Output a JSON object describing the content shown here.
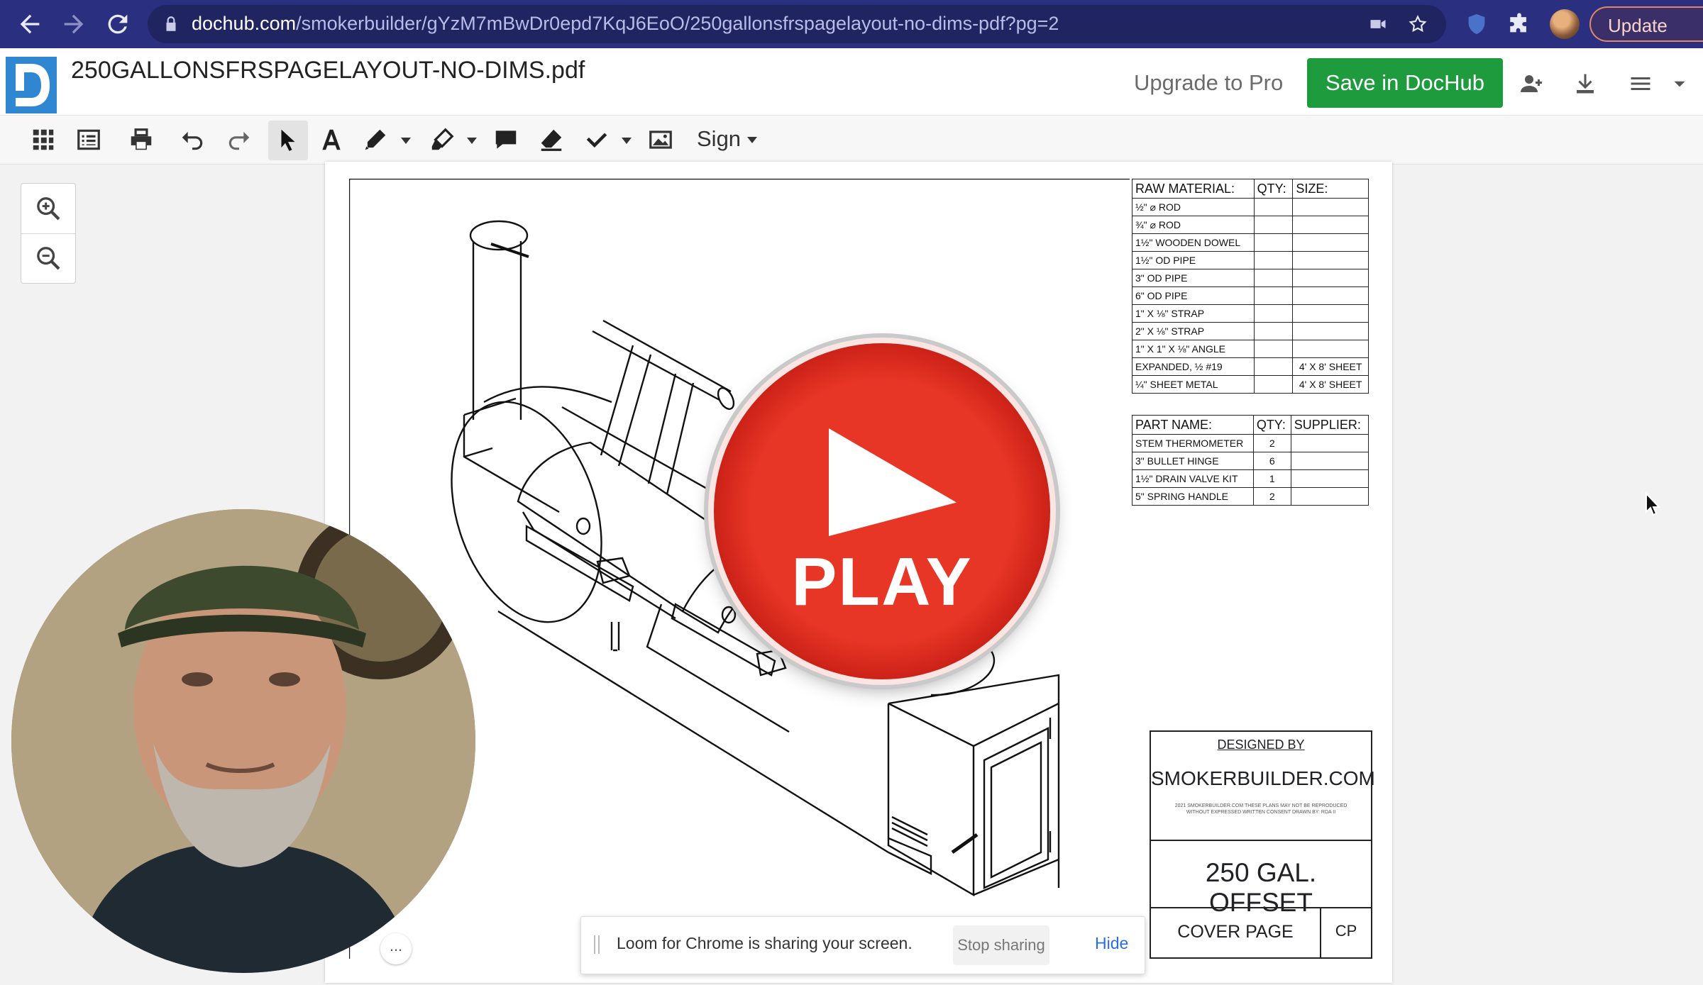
{
  "browser": {
    "url_domain": "dochub.com",
    "url_path": "/smokerbuilder/gYzM7mBwDr0epd7KqJ6EoO/250gallonsfrspagelayout-no-dims-pdf?pg=2",
    "update_label": "Update"
  },
  "header": {
    "doc_title": "250GALLONSFRSPAGELAYOUT-NO-DIMS.pdf",
    "upgrade_label": "Upgrade to Pro",
    "save_label": "Save in DocHub"
  },
  "toolbar": {
    "sign_label": "Sign"
  },
  "raw_material_table": {
    "headers": [
      "RAW MATERIAL:",
      "QTY:",
      "SIZE:"
    ],
    "rows": [
      [
        "½\" ⌀ ROD",
        "",
        ""
      ],
      [
        "¾\" ⌀ ROD",
        "",
        ""
      ],
      [
        "1½\" WOODEN DOWEL",
        "",
        ""
      ],
      [
        "1½\" OD PIPE",
        "",
        ""
      ],
      [
        "3\" OD PIPE",
        "",
        ""
      ],
      [
        "6\" OD PIPE",
        "",
        ""
      ],
      [
        "1\" X ⅛\" STRAP",
        "",
        ""
      ],
      [
        "2\" X ⅛\" STRAP",
        "",
        ""
      ],
      [
        "1\" X 1\" X ⅛\" ANGLE",
        "",
        ""
      ],
      [
        "EXPANDED, ½ #19",
        "",
        "4' X 8' SHEET"
      ],
      [
        "¼\" SHEET METAL",
        "",
        "4' X 8' SHEET"
      ]
    ]
  },
  "parts_table": {
    "headers": [
      "PART NAME:",
      "QTY:",
      "SUPPLIER:"
    ],
    "rows": [
      [
        "STEM THERMOMETER",
        "2",
        ""
      ],
      [
        "3\" BULLET HINGE",
        "6",
        ""
      ],
      [
        "1½\" DRAIN VALVE KIT",
        "1",
        ""
      ],
      [
        "5\" SPRING HANDLE",
        "2",
        ""
      ]
    ]
  },
  "title_block": {
    "designed_by": "DESIGNED BY",
    "site": "SMOKERBUILDER.COM",
    "fine_print": "2021 SMOKERBUILDER.COM THESE PLANS MAY NOT BE REPRODUCED WITHOUT EXPRESSED WRITTEN CONSENT DRAWN BY: RDA II",
    "model": "250 GAL. OFFSET",
    "sheet_name": "COVER PAGE",
    "sheet_code": "CP"
  },
  "overlay": {
    "play_label": "PLAY"
  },
  "loom": {
    "message": "Loom for Chrome is sharing your screen.",
    "stop_label": "Stop sharing",
    "hide_label": "Hide",
    "menu_label": "..."
  },
  "colors": {
    "chrome": "#2b2f7f",
    "save_button": "#1e9b3d",
    "logo": "#2f86d1",
    "play": "#e83626",
    "loom_hide_link": "#2a6de0"
  }
}
